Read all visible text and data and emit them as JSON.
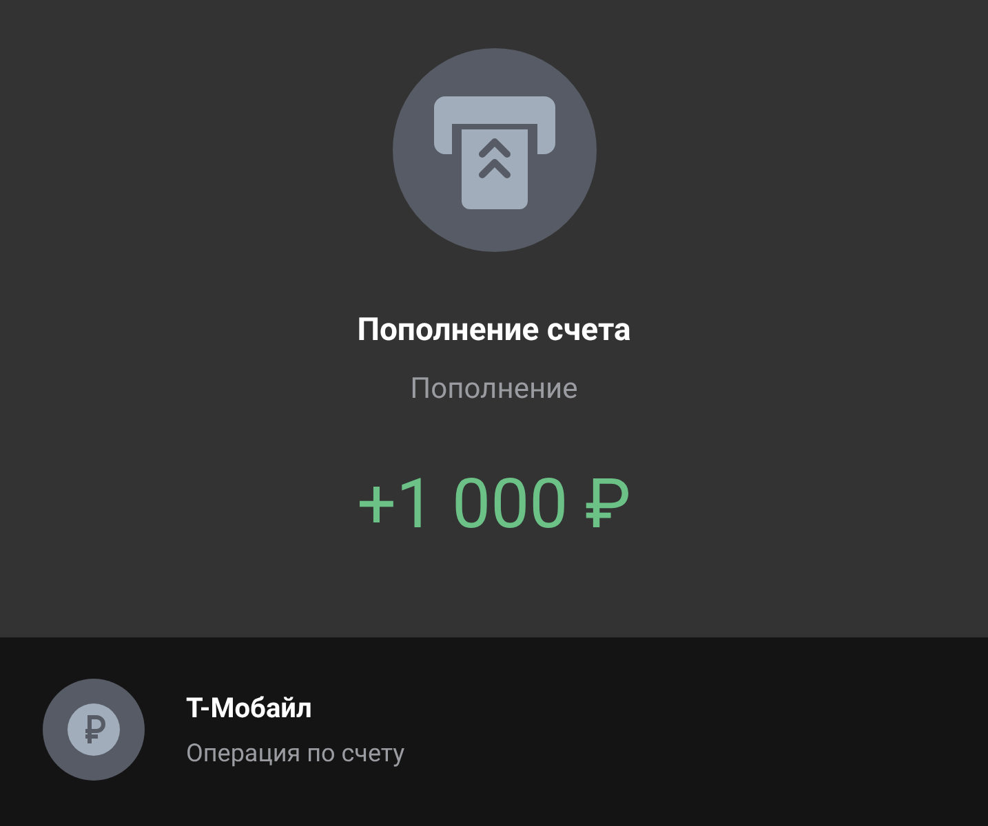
{
  "header": {
    "title": "Пополнение счета",
    "subtitle": "Пополнение",
    "amount": "+1 000 ₽"
  },
  "operation": {
    "title": "Т-Мобайл",
    "subtitle": "Операция по счету"
  }
}
